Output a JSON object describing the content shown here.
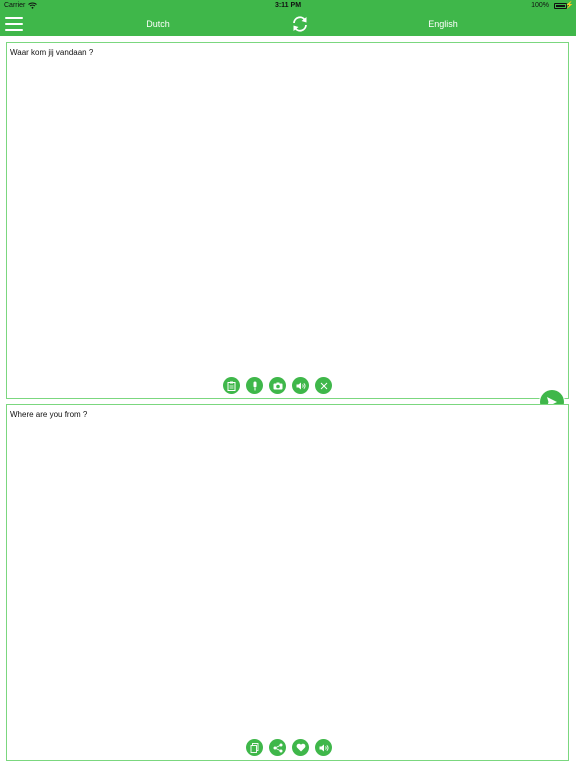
{
  "status_bar": {
    "carrier": "Carrier",
    "time": "3:11 PM",
    "battery_percent": "100%"
  },
  "nav": {
    "source_language": "Dutch",
    "target_language": "English"
  },
  "source_panel": {
    "text": "Waar kom jij vandaan ?",
    "tools": [
      "clipboard-icon",
      "microphone-icon",
      "camera-icon",
      "speaker-icon",
      "close-icon"
    ]
  },
  "target_panel": {
    "text": "Where are you from ?",
    "tools": [
      "copy-icon",
      "share-icon",
      "heart-icon",
      "speaker-icon"
    ]
  },
  "colors": {
    "accent": "#3fb74a",
    "panel_border": "#7bd77f"
  }
}
